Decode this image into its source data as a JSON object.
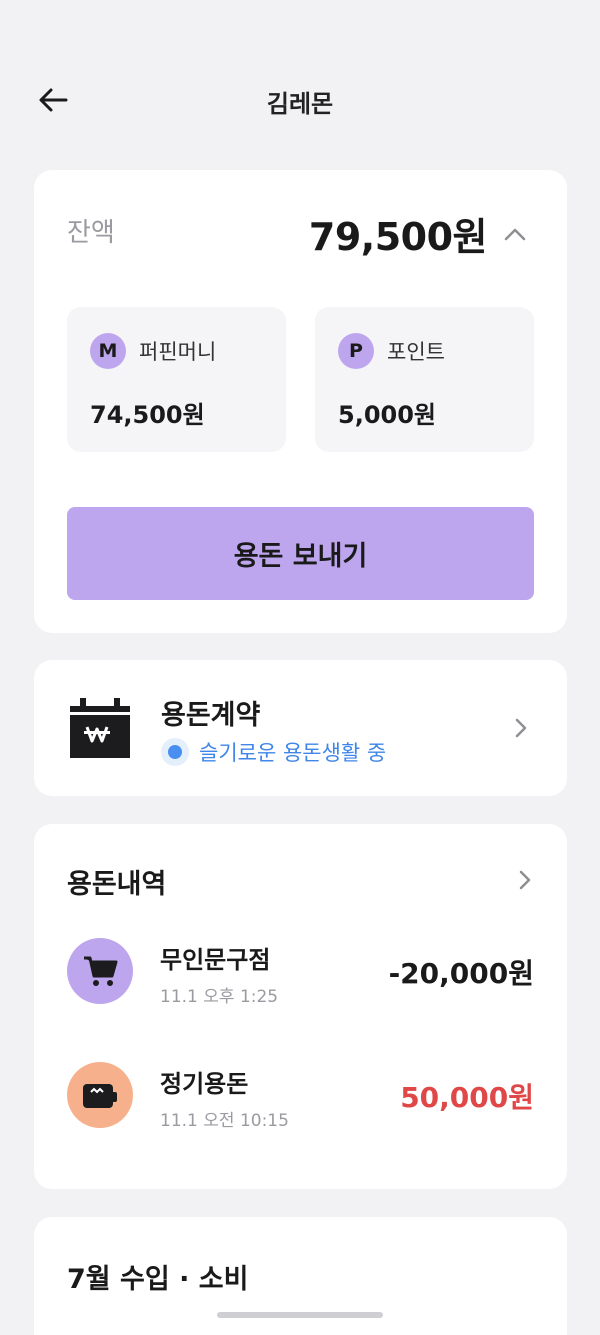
{
  "header": {
    "title": "김레몬"
  },
  "balance": {
    "label": "잔액",
    "total": "79,500원",
    "money": {
      "badge": "M",
      "label": "퍼핀머니",
      "value": "74,500원"
    },
    "point": {
      "badge": "P",
      "label": "포인트",
      "value": "5,000원"
    },
    "send_button": "용돈 보내기"
  },
  "contract": {
    "title": "용돈계약",
    "status": "슬기로운 용돈생활 중"
  },
  "history": {
    "title": "용돈내역",
    "items": [
      {
        "name": "무인문구점",
        "date": "11.1 오후 1:25",
        "amount": "-20,000원",
        "amount_color": "#1a1a1a",
        "icon": "cart-icon",
        "icon_bg": "#bda6ee"
      },
      {
        "name": "정기용돈",
        "date": "11.1 오전 10:15",
        "amount": "50,000원",
        "amount_color": "#e04848",
        "icon": "wallet-icon",
        "icon_bg": "#f7b08c"
      }
    ]
  },
  "summary": {
    "title": "7월 수입 · 소비"
  },
  "colors": {
    "accent": "#bda6ee",
    "status_blue": "#3f86e8",
    "income_red": "#e04848",
    "background": "#f2f1f4"
  }
}
